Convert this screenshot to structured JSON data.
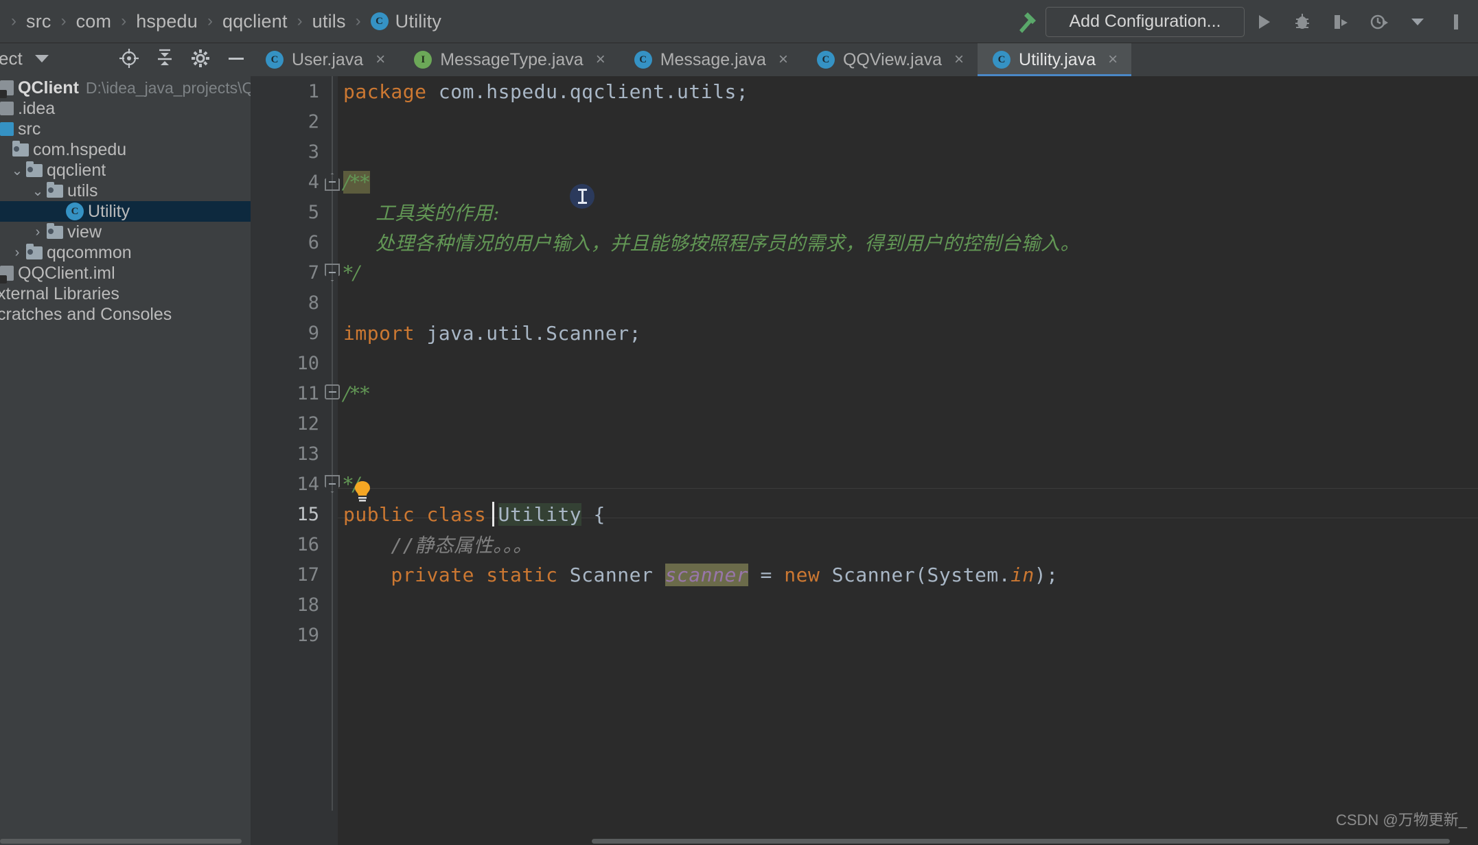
{
  "breadcrumb": {
    "items": [
      "src",
      "com",
      "hspedu",
      "qqclient",
      "utils"
    ],
    "leaf": "Utility",
    "leaf_icon": "class-icon",
    "separator": "›"
  },
  "toolbar": {
    "build_icon": "hammer-icon",
    "add_configuration_label": "Add Configuration...",
    "run_icon": "run-icon",
    "debug_icon": "debug-icon",
    "run_coverage_icon": "run-with-coverage-icon",
    "profiler_icon": "profiler-icon",
    "more_icon": "chevron-down-icon"
  },
  "sidebar": {
    "title": "ect",
    "title_caret": "chevron-down-icon",
    "actions": [
      "locate-icon",
      "collapse-all-icon",
      "settings-gear-icon",
      "hide-icon"
    ],
    "tree": [
      {
        "label": "QClient",
        "path": "D:\\idea_java_projects\\QQClient",
        "icon": "project-icon",
        "indent": 0,
        "chevron": "",
        "bold": true,
        "selected": false
      },
      {
        "label": ".idea",
        "path": "",
        "icon": "folder-square-icon",
        "indent": 0,
        "chevron": "",
        "bold": false,
        "selected": false
      },
      {
        "label": "src",
        "path": "",
        "icon": "source-root-icon",
        "indent": 0,
        "chevron": "",
        "bold": false,
        "selected": false
      },
      {
        "label": "com.hspedu",
        "path": "",
        "icon": "package-icon",
        "indent": 1,
        "chevron": "",
        "bold": false,
        "selected": false
      },
      {
        "label": "qqclient",
        "path": "",
        "icon": "package-icon",
        "indent": 1,
        "chevron": "⌄",
        "bold": false,
        "selected": false
      },
      {
        "label": "utils",
        "path": "",
        "icon": "package-icon",
        "indent": 2,
        "chevron": "⌄",
        "bold": false,
        "selected": false
      },
      {
        "label": "Utility",
        "path": "",
        "icon": "class-icon",
        "indent": 4,
        "chevron": "",
        "bold": false,
        "selected": true
      },
      {
        "label": "view",
        "path": "",
        "icon": "package-icon",
        "indent": 2,
        "chevron": "›",
        "bold": false,
        "selected": false
      },
      {
        "label": "qqcommon",
        "path": "",
        "icon": "package-icon",
        "indent": 1,
        "chevron": "›",
        "bold": false,
        "selected": false
      },
      {
        "label": "QQClient.iml",
        "path": "",
        "icon": "iml-file-icon",
        "indent": 0,
        "chevron": "",
        "bold": false,
        "selected": false
      },
      {
        "label": "xternal Libraries",
        "path": "",
        "icon": "library-icon",
        "indent": 0,
        "chevron": "",
        "bold": false,
        "selected": false
      },
      {
        "label": "cratches and Consoles",
        "path": "",
        "icon": "scratches-icon",
        "indent": 0,
        "chevron": "",
        "bold": false,
        "selected": false
      }
    ]
  },
  "tabs": [
    {
      "label": "User.java",
      "icon": "class-icon",
      "kind": "class",
      "active": false,
      "close": "×"
    },
    {
      "label": "MessageType.java",
      "icon": "interface-icon",
      "kind": "interface",
      "active": false,
      "close": "×"
    },
    {
      "label": "Message.java",
      "icon": "class-icon",
      "kind": "class",
      "active": false,
      "close": "×"
    },
    {
      "label": "QQView.java",
      "icon": "class-icon",
      "kind": "class",
      "active": false,
      "close": "×"
    },
    {
      "label": "Utility.java",
      "icon": "class-icon",
      "kind": "class",
      "active": true,
      "close": "×"
    }
  ],
  "editor": {
    "colors": {
      "background": "#2b2b2b",
      "gutter": "#313335",
      "keyword": "#cc7832",
      "comment": "#629755",
      "line_comment": "#808080",
      "identifier": "#a9b7c6",
      "field": "#9876aa",
      "selection_highlight": "#344134",
      "accent_blue": "#3592c4"
    },
    "lines": [
      {
        "no": "1",
        "segments": [
          {
            "t": "package ",
            "c": "kw"
          },
          {
            "t": "com.hspedu.qqclient.utils;",
            "c": "plain"
          }
        ],
        "fold": ""
      },
      {
        "no": "2",
        "segments": [],
        "fold": ""
      },
      {
        "no": "3",
        "segments": [],
        "fold": ""
      },
      {
        "no": "4",
        "segments": [
          {
            "t": "/**",
            "c": "cmt hl-olive"
          }
        ],
        "fold": "start"
      },
      {
        "no": "5",
        "segments": [
          {
            "t": "     工具类的作用:",
            "c": "cmt"
          }
        ],
        "fold": ""
      },
      {
        "no": "6",
        "segments": [
          {
            "t": "     处理各种情况的用户输入，并且能够按照程序员的需求，得到用户的控制台输入。",
            "c": "cmt"
          }
        ],
        "fold": ""
      },
      {
        "no": "7",
        "segments": [
          {
            "t": "*/",
            "c": "cmt"
          }
        ],
        "fold": "end"
      },
      {
        "no": "8",
        "segments": [],
        "fold": ""
      },
      {
        "no": "9",
        "segments": [
          {
            "t": "import ",
            "c": "kw"
          },
          {
            "t": "java.util.Scanner;",
            "c": "plain"
          }
        ],
        "fold": ""
      },
      {
        "no": "10",
        "segments": [],
        "fold": ""
      },
      {
        "no": "11",
        "segments": [
          {
            "t": "/**",
            "c": "cmt"
          }
        ],
        "fold": "start"
      },
      {
        "no": "12",
        "segments": [],
        "fold": ""
      },
      {
        "no": "13",
        "segments": [],
        "fold": ""
      },
      {
        "no": "14",
        "segments": [
          {
            "t": "*/",
            "c": "cmt"
          }
        ],
        "fold": "end"
      },
      {
        "no": "15",
        "segments": [
          {
            "t": "public class ",
            "c": "kw"
          },
          {
            "t": "Utility",
            "c": "ident hl-ident"
          },
          {
            "t": " {",
            "c": "plain"
          }
        ],
        "fold": ""
      },
      {
        "no": "16",
        "segments": [
          {
            "t": "    //静态属性。。。",
            "c": "cmt-line"
          }
        ],
        "fold": ""
      },
      {
        "no": "17",
        "segments": [
          {
            "t": "    private static ",
            "c": "kw"
          },
          {
            "t": "Scanner ",
            "c": "plain"
          },
          {
            "t": "scanner",
            "c": "field hl-field"
          },
          {
            "t": " = ",
            "c": "plain"
          },
          {
            "t": "new ",
            "c": "kw"
          },
          {
            "t": "Scanner(System.",
            "c": "plain"
          },
          {
            "t": "in",
            "c": "kw"
          },
          {
            "t": ");",
            "c": "plain"
          }
        ],
        "fold": ""
      },
      {
        "no": "18",
        "segments": [],
        "fold": ""
      },
      {
        "no": "19",
        "segments": [],
        "fold": ""
      }
    ],
    "caret_line": "15",
    "intention_bulb_icon": "lightbulb-icon",
    "mouse_cursor_icon": "text-i-beam-cursor"
  },
  "watermark": "CSDN @万物更新_"
}
